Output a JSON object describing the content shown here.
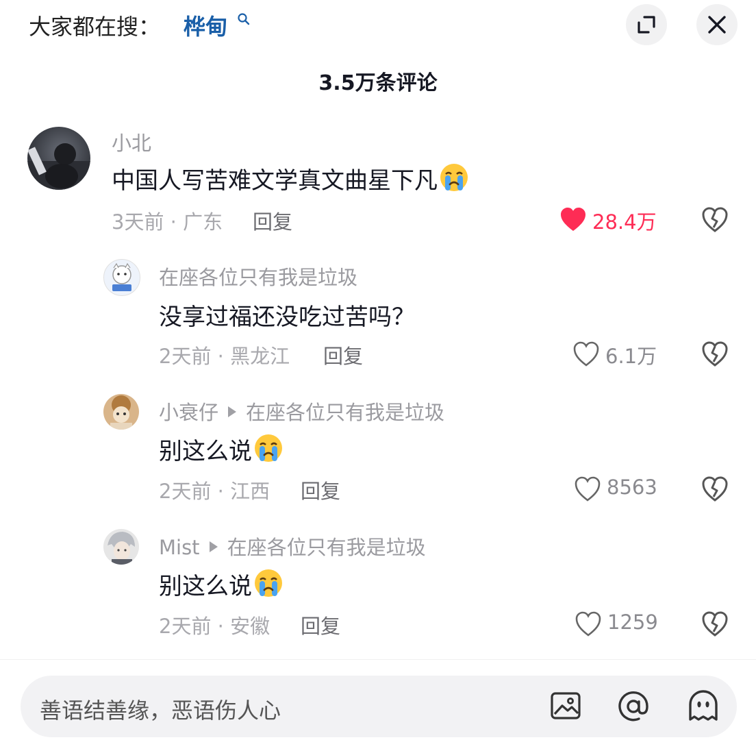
{
  "header": {
    "hot_label": "大家都在搜：",
    "hot_term": "桦甸",
    "comment_count": "3.5万条评论"
  },
  "icons": {
    "search": "search-icon",
    "collapse": "collapse-icon",
    "close": "close-icon",
    "heart": "heart-icon",
    "broken_heart": "broken-heart-icon",
    "crying_emoji": "crying-emoji-icon",
    "image": "image-icon",
    "at": "at-icon",
    "sticker": "sticker-face-icon"
  },
  "colors": {
    "liked_heart": "#fe2c55",
    "hot_term": "#1a5fa8"
  },
  "comments": [
    {
      "name": "小北",
      "reply_to": "",
      "text": "中国人写苦难文学真文曲星下凡",
      "meta": "3天前 · 广东",
      "reply": "回复",
      "likes": "28.4万",
      "liked": true
    },
    {
      "name": "在座各位只有我是垃圾",
      "reply_to": "",
      "text": "没享过福还没吃过苦吗？",
      "meta": "2天前 · 黑龙江",
      "reply": "回复",
      "likes": "6.1万",
      "liked": false
    },
    {
      "name": "小衰仔",
      "reply_to": "在座各位只有我是垃圾",
      "text": "别这么说",
      "meta": "2天前 · 江西",
      "reply": "回复",
      "likes": "8563",
      "liked": false
    },
    {
      "name": "Mist",
      "reply_to": "在座各位只有我是垃圾",
      "text": "别这么说",
      "meta": "2天前 · 安徽",
      "reply": "回复",
      "likes": "1259",
      "liked": false
    }
  ],
  "input": {
    "placeholder": "善语结善缘，恶语伤人心"
  }
}
